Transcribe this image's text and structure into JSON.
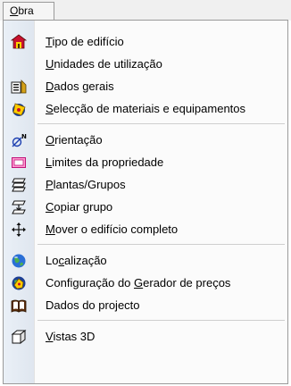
{
  "menubar": {
    "title_prefix": "",
    "title_accel": "O",
    "title_rest": "bra"
  },
  "menu": {
    "items": [
      {
        "pre": "",
        "accel": "T",
        "post": "ipo de edifício",
        "icon": "building-icon"
      },
      {
        "pre": "",
        "accel": "U",
        "post": "nidades de utilização",
        "icon": "none"
      },
      {
        "pre": "",
        "accel": "D",
        "post": "ados gerais",
        "icon": "general-data-icon"
      },
      {
        "pre": "",
        "accel": "S",
        "post": "elecção de materiais e equipamentos",
        "icon": "materials-icon"
      },
      {
        "pre": "",
        "accel": "O",
        "post": "rientação",
        "icon": "orientation-icon"
      },
      {
        "pre": "",
        "accel": "L",
        "post": "imites da propriedade",
        "icon": "property-limits-icon"
      },
      {
        "pre": "",
        "accel": "P",
        "post": "lantas/Grupos",
        "icon": "floors-icon"
      },
      {
        "pre": "",
        "accel": "C",
        "post": "opiar grupo",
        "icon": "copy-group-icon"
      },
      {
        "pre": "",
        "accel": "M",
        "post": "over o edifício completo",
        "icon": "move-icon"
      },
      {
        "pre": "Lo",
        "accel": "c",
        "post": "alização",
        "icon": "globe-icon"
      },
      {
        "pre": "Configuração do ",
        "accel": "G",
        "post": "erador de preços",
        "icon": "price-generator-icon"
      },
      {
        "pre": "Dados do projecto",
        "accel": "",
        "post": "",
        "icon": "project-book-icon"
      },
      {
        "pre": "",
        "accel": "V",
        "post": "istas 3D",
        "icon": "3d-views-icon"
      }
    ]
  }
}
